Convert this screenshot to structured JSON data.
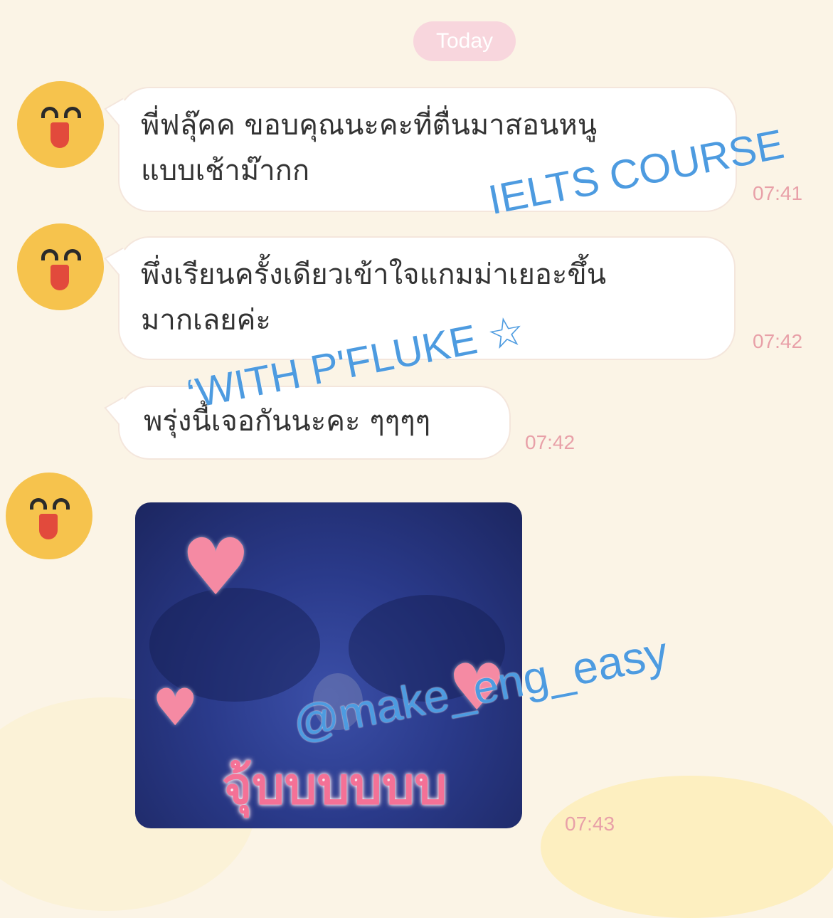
{
  "date_chip": "Today",
  "messages": [
    {
      "line1": "พี่ฟลุ๊คค ขอบคุณนะคะที่ตื่นมาสอนหนู",
      "line2": "แบบเช้าม๊ากก",
      "time": "07:41"
    },
    {
      "line1": "พึ่งเรียนครั้งเดียวเข้าใจแกมม่าเยอะขึ้น",
      "line2": "มากเลยค่ะ",
      "time": "07:42"
    },
    {
      "line1": "พรุ่งนี้เจอกันนะคะ ๆๆๆๆ",
      "time": "07:42"
    }
  ],
  "photo": {
    "sticker_text": "จุ้บบบบบบ",
    "time": "07:43"
  },
  "watermarks": {
    "course": "IELTS COURSE",
    "with": "‘WITH P'FLUKE ☆",
    "handle": "@make_eng_easy"
  },
  "colors": {
    "accent_pink": "#f8d6dd",
    "timestamp": "#e8a0a8",
    "watermark": "#4d9be0"
  }
}
